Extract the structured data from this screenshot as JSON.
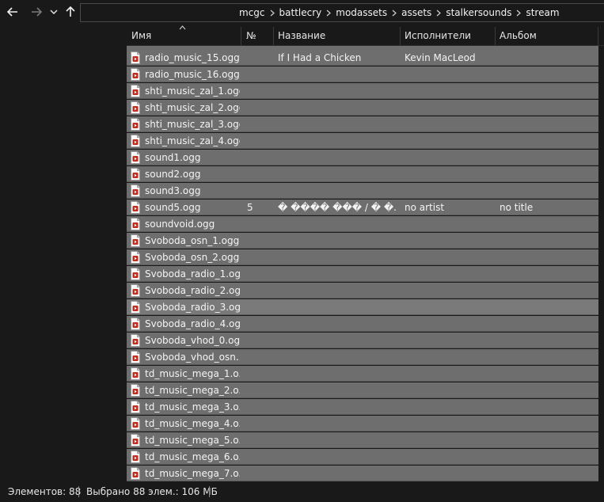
{
  "nav": {
    "back_icon": "arrow-left-icon",
    "forward_icon": "arrow-right-icon",
    "recent_icon": "chevron-down-icon",
    "up_icon": "arrow-up-icon"
  },
  "breadcrumb": [
    "mcgc",
    "battlecry",
    "modassets",
    "assets",
    "stalkersounds",
    "stream"
  ],
  "columns": {
    "name": "Имя",
    "number": "№",
    "title": "Название",
    "artists": "Исполнители",
    "album": "Альбом"
  },
  "files": [
    {
      "name": "radio_music_15.ogg",
      "number": "",
      "title": "If I Had a Chicken",
      "artists": "Kevin MacLeod",
      "album": ""
    },
    {
      "name": "radio_music_16.ogg",
      "number": "",
      "title": "",
      "artists": "",
      "album": ""
    },
    {
      "name": "shti_music_zal_1.ogg",
      "number": "",
      "title": "",
      "artists": "",
      "album": ""
    },
    {
      "name": "shti_music_zal_2.ogg",
      "number": "",
      "title": "",
      "artists": "",
      "album": ""
    },
    {
      "name": "shti_music_zal_3.ogg",
      "number": "",
      "title": "",
      "artists": "",
      "album": ""
    },
    {
      "name": "shti_music_zal_4.ogg",
      "number": "",
      "title": "",
      "artists": "",
      "album": ""
    },
    {
      "name": "sound1.ogg",
      "number": "",
      "title": "",
      "artists": "",
      "album": ""
    },
    {
      "name": "sound2.ogg",
      "number": "",
      "title": "",
      "artists": "",
      "album": ""
    },
    {
      "name": "sound3.ogg",
      "number": "",
      "title": "",
      "artists": "",
      "album": ""
    },
    {
      "name": "sound5.ogg",
      "number": "5",
      "title": "� ���� ��� / � �...",
      "artists": "no artist",
      "album": "no title"
    },
    {
      "name": "soundvoid.ogg",
      "number": "",
      "title": "",
      "artists": "",
      "album": ""
    },
    {
      "name": "Svoboda_osn_1.ogg",
      "number": "",
      "title": "",
      "artists": "",
      "album": ""
    },
    {
      "name": "Svoboda_osn_2.ogg",
      "number": "",
      "title": "",
      "artists": "",
      "album": ""
    },
    {
      "name": "Svoboda_radio_1.ogg",
      "number": "",
      "title": "",
      "artists": "",
      "album": ""
    },
    {
      "name": "Svoboda_radio_2.ogg",
      "number": "",
      "title": "",
      "artists": "",
      "album": ""
    },
    {
      "name": "Svoboda_radio_3.ogg",
      "number": "",
      "title": "",
      "artists": "",
      "album": "",
      "hovered": true
    },
    {
      "name": "Svoboda_radio_4.ogg",
      "number": "",
      "title": "",
      "artists": "",
      "album": ""
    },
    {
      "name": "Svoboda_vhod_0.ogg",
      "number": "",
      "title": "",
      "artists": "",
      "album": ""
    },
    {
      "name": "Svoboda_vhod_osn...",
      "number": "",
      "title": "",
      "artists": "",
      "album": ""
    },
    {
      "name": "td_music_mega_1.o...",
      "number": "",
      "title": "",
      "artists": "",
      "album": ""
    },
    {
      "name": "td_music_mega_2.o...",
      "number": "",
      "title": "",
      "artists": "",
      "album": ""
    },
    {
      "name": "td_music_mega_3.o...",
      "number": "",
      "title": "",
      "artists": "",
      "album": ""
    },
    {
      "name": "td_music_mega_4.o...",
      "number": "",
      "title": "",
      "artists": "",
      "album": ""
    },
    {
      "name": "td_music_mega_5.o...",
      "number": "",
      "title": "",
      "artists": "",
      "album": ""
    },
    {
      "name": "td_music_mega_6.o...",
      "number": "",
      "title": "",
      "artists": "",
      "album": ""
    },
    {
      "name": "td_music_mega_7.o...",
      "number": "",
      "title": "",
      "artists": "",
      "album": ""
    }
  ],
  "file_icon": "audio-file-icon",
  "status": {
    "items_count": "Элементов: 88",
    "selected": "Выбрано 88 элем.: 106 МБ"
  },
  "colors": {
    "background": "#191919",
    "row_selected": "#6e6e6e",
    "row_hover": "#7a7a7a",
    "icon_accent": "#c42b1c"
  }
}
